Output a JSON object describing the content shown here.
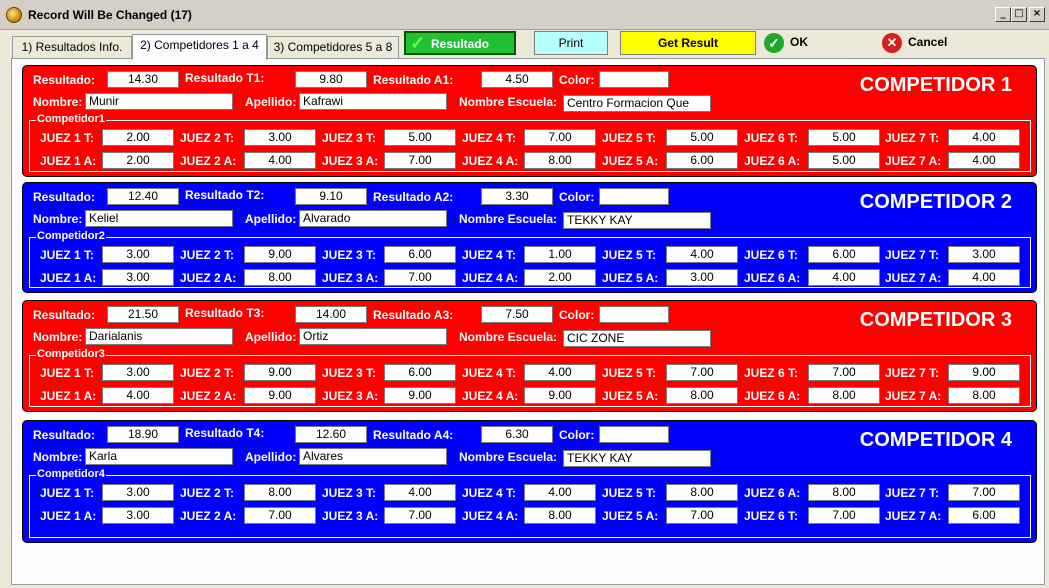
{
  "window": {
    "title": "Record Will Be Changed  (17)",
    "min": "_",
    "max": "□",
    "close": "×"
  },
  "tabs": [
    "1) Resultados Info.",
    "2) Competidores 1 a 4",
    "3) Competidores 5 a 8"
  ],
  "toolbar": {
    "resultado": "Resultado",
    "print": "Print",
    "get_result": "Get Result",
    "ok": "OK",
    "cancel": "Cancel"
  },
  "labels": {
    "resultado": "Resultado:",
    "color": "Color:",
    "nombre": "Nombre:",
    "apellido": "Apellido:",
    "escuela": "Nombre Escuela:"
  },
  "competitors": [
    {
      "title": "COMPETIDOR   1",
      "color": "#ff0000",
      "resultado": "14.30",
      "t_label": "Resultado T1:",
      "t": "9.80",
      "a_label": "Resultado A1:",
      "a": "4.50",
      "color_value": "",
      "nombre": "Munir",
      "apellido": "Kafrawi",
      "escuela": "Centro Formacion Que",
      "group": "Competidor1",
      "row1": [
        {
          "l": "JUEZ 1 T:",
          "v": "2.00"
        },
        {
          "l": "JUEZ 2 T:",
          "v": "3.00"
        },
        {
          "l": "JUEZ 3 T:",
          "v": "5.00"
        },
        {
          "l": "JUEZ 4 T:",
          "v": "7.00"
        },
        {
          "l": "JUEZ 5 T:",
          "v": "5.00"
        },
        {
          "l": "JUEZ 6 T:",
          "v": "5.00"
        },
        {
          "l": "JUEZ 7 T:",
          "v": "4.00"
        }
      ],
      "row2": [
        {
          "l": "JUEZ 1 A:",
          "v": "2.00"
        },
        {
          "l": "JUEZ 2 A:",
          "v": "4.00"
        },
        {
          "l": "JUEZ 3 A:",
          "v": "7.00"
        },
        {
          "l": "JUEZ 4 A:",
          "v": "8.00"
        },
        {
          "l": "JUEZ 5 A:",
          "v": "6.00"
        },
        {
          "l": "JUEZ 6 A:",
          "v": "5.00"
        },
        {
          "l": "JUEZ 7 A:",
          "v": "4.00"
        }
      ]
    },
    {
      "title": "COMPETIDOR  2",
      "color": "#0000ff",
      "resultado": "12.40",
      "t_label": "Resultado T2:",
      "t": "9.10",
      "a_label": "Resultado A2:",
      "a": "3.30",
      "color_value": "",
      "nombre": "Keliel",
      "apellido": "Alvarado",
      "escuela": "TEKKY KAY",
      "group": "Competidor2",
      "row1": [
        {
          "l": "JUEZ 1 T:",
          "v": "3.00"
        },
        {
          "l": "JUEZ 2 T:",
          "v": "9.00"
        },
        {
          "l": "JUEZ 3 T:",
          "v": "6.00"
        },
        {
          "l": "JUEZ 4 T:",
          "v": "1.00"
        },
        {
          "l": "JUEZ 5 T:",
          "v": "4.00"
        },
        {
          "l": "JUEZ 6 T:",
          "v": "6.00"
        },
        {
          "l": "JUEZ 7 T:",
          "v": "3.00"
        }
      ],
      "row2": [
        {
          "l": "JUEZ 1 A:",
          "v": "3.00"
        },
        {
          "l": "JUEZ 2 A:",
          "v": "8.00"
        },
        {
          "l": "JUEZ 3 A:",
          "v": "7.00"
        },
        {
          "l": "JUEZ 4 A:",
          "v": "2.00"
        },
        {
          "l": "JUEZ 5 A:",
          "v": "3.00"
        },
        {
          "l": "JUEZ 6 A:",
          "v": "4.00"
        },
        {
          "l": "JUEZ 7 A:",
          "v": "4.00"
        }
      ]
    },
    {
      "title": "COMPETIDOR   3",
      "color": "#ff0000",
      "resultado": "21.50",
      "t_label": "Resultado T3:",
      "t": "14.00",
      "a_label": "Resultado A3:",
      "a": "7.50",
      "color_value": "",
      "nombre": "Darialanis",
      "apellido": "Ortiz",
      "escuela": "CIC ZONE",
      "group": "Competidor3",
      "row1": [
        {
          "l": "JUEZ 1 T:",
          "v": "3.00"
        },
        {
          "l": "JUEZ 2 T:",
          "v": "9.00"
        },
        {
          "l": "JUEZ 3 T:",
          "v": "6.00"
        },
        {
          "l": "JUEZ 4 T:",
          "v": "4.00"
        },
        {
          "l": "JUEZ 5 T:",
          "v": "7.00"
        },
        {
          "l": "JUEZ 6 T:",
          "v": "7.00"
        },
        {
          "l": "JUEZ 7 T:",
          "v": "9.00"
        }
      ],
      "row2": [
        {
          "l": "JUEZ 1 A:",
          "v": "4.00"
        },
        {
          "l": "JUEZ 2 A:",
          "v": "9.00"
        },
        {
          "l": "JUEZ 3 A:",
          "v": "9.00"
        },
        {
          "l": "JUEZ 4 A:",
          "v": "9.00"
        },
        {
          "l": "JUEZ 5 A:",
          "v": "8.00"
        },
        {
          "l": "JUEZ 6 A:",
          "v": "8.00"
        },
        {
          "l": "JUEZ 7 A:",
          "v": "8.00"
        }
      ]
    },
    {
      "title": "COMPETIDOR   4",
      "color": "#0000ff",
      "resultado": "18.90",
      "t_label": "Resultado T4:",
      "t": "12.60",
      "a_label": "Resultado A4:",
      "a": "6.30",
      "color_value": "",
      "nombre": "Karla",
      "apellido": "Alvares",
      "escuela": "TEKKY KAY",
      "group": "Competidor4",
      "row1": [
        {
          "l": "JUEZ 1 T:",
          "v": "3.00"
        },
        {
          "l": "JUEZ 2 T:",
          "v": "8.00"
        },
        {
          "l": "JUEZ 3 T:",
          "v": "4.00"
        },
        {
          "l": "JUEZ 4 T:",
          "v": "4.00"
        },
        {
          "l": "JUEZ 5 T:",
          "v": "8.00"
        },
        {
          "l": "JUEZ 6 A:",
          "v": "8.00"
        },
        {
          "l": "JUEZ 7 T:",
          "v": "7.00"
        }
      ],
      "row2": [
        {
          "l": "JUEZ 1 A:",
          "v": "3.00"
        },
        {
          "l": "JUEZ 2 A:",
          "v": "7.00"
        },
        {
          "l": "JUEZ 3 A:",
          "v": "7.00"
        },
        {
          "l": "JUEZ 4 A:",
          "v": "8.00"
        },
        {
          "l": "JUEZ 5 A:",
          "v": "7.00"
        },
        {
          "l": "JUEZ 6 T:",
          "v": "7.00"
        },
        {
          "l": "JUEZ 7 A:",
          "v": "6.00"
        }
      ]
    }
  ]
}
